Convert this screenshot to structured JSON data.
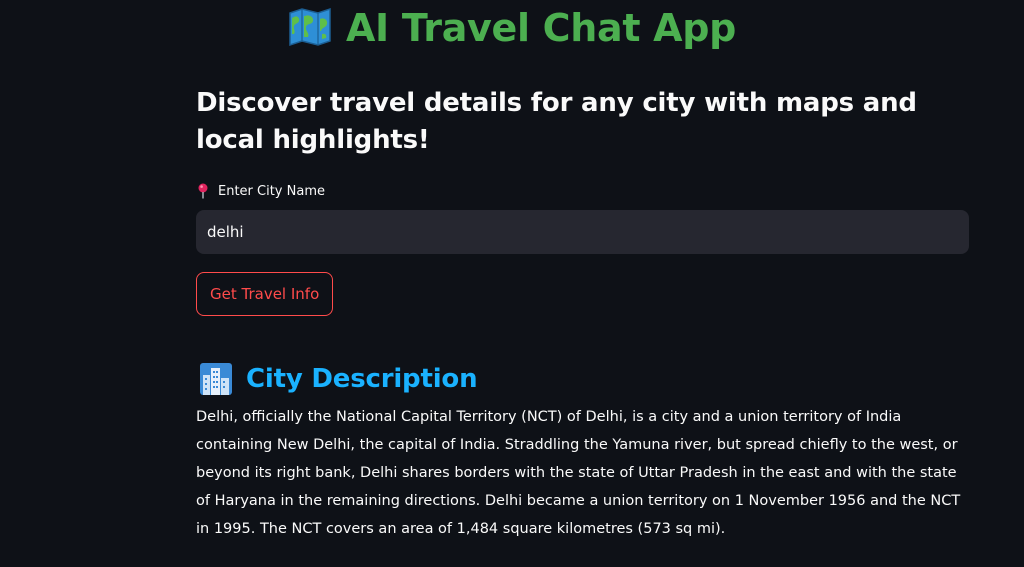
{
  "app": {
    "title": "AI Travel Chat App",
    "title_icon": "world-map-icon",
    "title_color": "#4caf50",
    "background": "#0e1117"
  },
  "intro": {
    "subtitle": "Discover travel details for any city with maps and local highlights!"
  },
  "city_field": {
    "label_icon": "round-pushpin-icon",
    "label": "Enter City Name",
    "value": "delhi"
  },
  "actions": {
    "get_info_label": "Get Travel Info",
    "accent": "#ff4b4b"
  },
  "description_section": {
    "icon": "cityscape-icon",
    "heading": "City Description",
    "heading_color": "#1ab2ff",
    "text": "Delhi, officially the National Capital Territory (NCT) of Delhi, is a city and a union territory of India containing New Delhi, the capital of India. Straddling the Yamuna river, but spread chiefly to the west, or beyond its right bank, Delhi shares borders with the state of Uttar Pradesh in the east and with the state of Haryana in the remaining directions. Delhi became a union territory on 1 November 1956 and the NCT in 1995. The NCT covers an area of 1,484 square kilometres (573 sq mi)."
  }
}
